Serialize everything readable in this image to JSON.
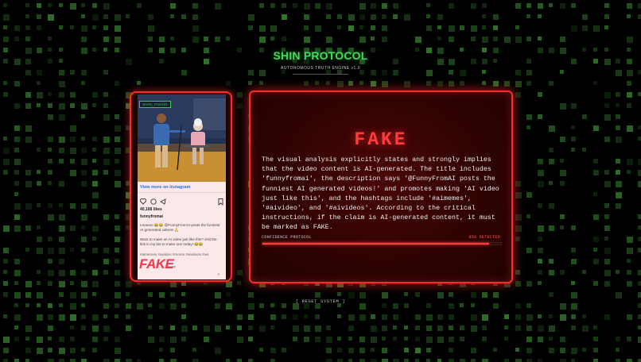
{
  "header": {
    "title": "SHIN PROTOCOL",
    "subtitle": "AUTONOMOUS TRUTH ENGINE v1.0"
  },
  "post": {
    "video_badge": "SHIN_VISION",
    "view_more": "View more on Instagram",
    "likes": "40,168 likes",
    "username": "funnyfromai",
    "caption": "Lmaooo 😂😂 @FunnyFromAI posts the funniest AI generated videos! 🙏",
    "caption2": "Want to make an AI video just like this? visit the link in my bio to make one today! 😂😂",
    "hashtags": "#aimemes #aivideo #meme #aivideos #ws",
    "stamp": "FAKE",
    "stamp_sub": "funny",
    "corner_meta": "↗"
  },
  "result": {
    "verdict": "FAKE",
    "analysis": "The visual analysis explicitly states and strongly implies that the video content is AI-generated. The title includes 'funnyfromai', the description says '@FunnyFromAI posts the funniest AI generated videos!' and promotes making 'AI video just like this', and the hashtags include '#aimemes', '#aivideo', and '#aivideos'. According to the critical instructions, if the claim is AI-generated content, it must be marked as FAKE.",
    "confidence_label": "CONFIDENCE PROTOCOL",
    "confidence_text": "95% DETECTED",
    "confidence_value": 95
  },
  "controls": {
    "reset_label": "[ RESET SYSTEM ]"
  },
  "colors": {
    "accent_green": "#3fe05a",
    "alert_red": "#ff2b2b",
    "background": "#000000"
  }
}
